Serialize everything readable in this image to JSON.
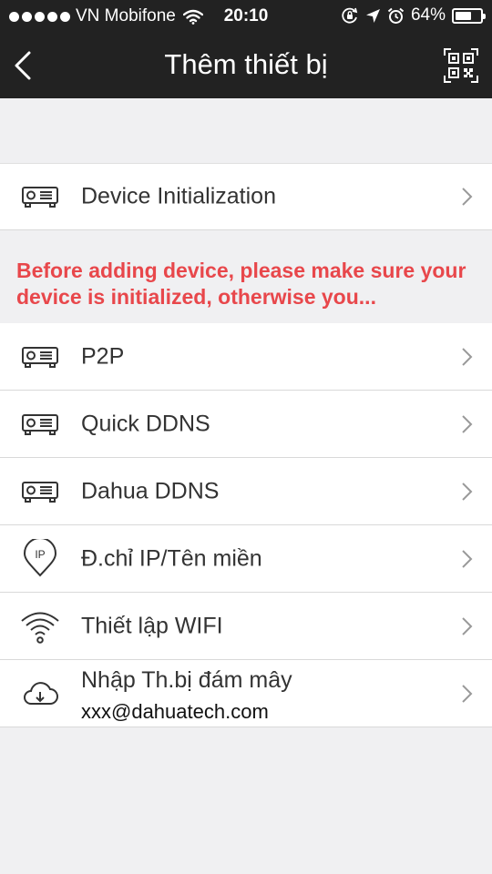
{
  "status_bar": {
    "carrier": "VN Mobifone",
    "time": "20:10",
    "battery": "64%",
    "battery_level": 0.64,
    "icons": [
      "signal-dots-icon",
      "wifi-icon",
      "rotation-lock-icon",
      "location-icon",
      "alarm-icon",
      "battery-icon"
    ]
  },
  "nav": {
    "title": "Thêm thiết bị",
    "back_icon": "chevron-left-icon",
    "qr_icon": "qr-scan-icon"
  },
  "device_init": {
    "label": "Device Initialization",
    "icon": "dvr-icon"
  },
  "warning": {
    "text": "Before adding device, please make sure your device is initialized, otherwise you..."
  },
  "items": [
    {
      "label": "P2P",
      "icon": "dvr-icon"
    },
    {
      "label": "Quick DDNS",
      "icon": "dvr-icon"
    },
    {
      "label": "Dahua DDNS",
      "icon": "dvr-icon"
    },
    {
      "label": "Đ.chỉ IP/Tên miền",
      "icon": "ip-pin-icon"
    },
    {
      "label": "Thiết lập WIFI",
      "icon": "wifi-icon"
    }
  ],
  "cloud": {
    "label": "Nhập Th.bị đám mây",
    "sublabel": "xxx@dahuatech.com",
    "icon": "cloud-download-icon"
  },
  "colors": {
    "bar_bg": "#222222",
    "warning_text": "#e8474b",
    "page_bg": "#f0f0f2"
  }
}
